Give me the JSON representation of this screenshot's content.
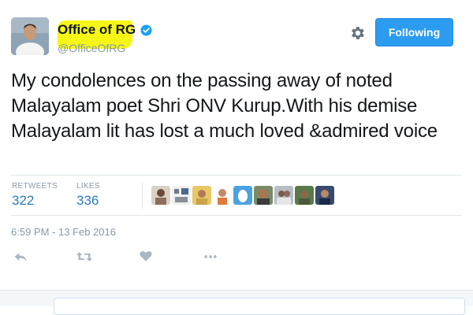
{
  "tweet": {
    "author": {
      "display_name": "Office of RG",
      "handle": "@OfficeOfRG",
      "verified": true,
      "avatar_icon": "profile-photo"
    },
    "follow_button_label": "Following",
    "settings_icon": "gear-icon",
    "text": "My condolences on the passing away of noted Malayalam poet Shri ONV Kurup.With his demise Malayalam lit has lost a much loved &admired voice",
    "stats": {
      "retweets_label": "RETWEETS",
      "retweets_count": "322",
      "likes_label": "LIKES",
      "likes_count": "336"
    },
    "likers": [
      {
        "icon": "liker-avatar-1"
      },
      {
        "icon": "liker-avatar-2"
      },
      {
        "icon": "liker-avatar-3"
      },
      {
        "icon": "liker-avatar-4"
      },
      {
        "icon": "liker-avatar-5"
      },
      {
        "icon": "liker-avatar-6"
      },
      {
        "icon": "liker-avatar-7"
      },
      {
        "icon": "liker-avatar-8"
      },
      {
        "icon": "liker-avatar-9"
      }
    ],
    "timestamp": "6:59 PM - 13 Feb 2016",
    "actions": [
      "reply-icon",
      "retweet-icon",
      "like-icon",
      "more-icon"
    ]
  },
  "colors": {
    "accent": "#2b9cf0",
    "link": "#2b7bb9",
    "muted": "#8899a6",
    "highlight": "#f5f50a",
    "verified": "#1da1f2"
  }
}
